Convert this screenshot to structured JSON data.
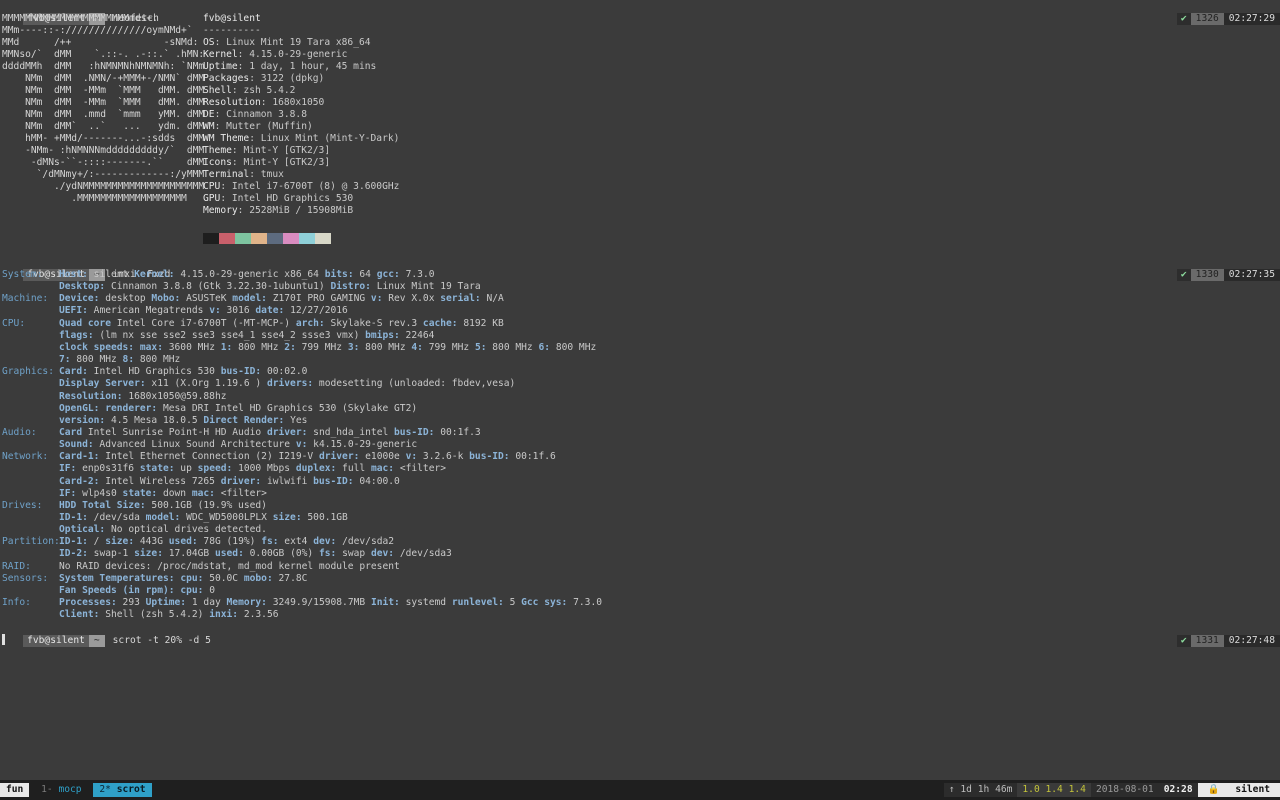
{
  "prompts": [
    {
      "host": "fvb@silent",
      "dir": "~",
      "command": "neofetch",
      "status": "✔",
      "hist": "1326",
      "time": "02:27:29"
    },
    {
      "host": "fvb@silent",
      "dir": "~",
      "command": "inxi -Fxzd",
      "status": "✔",
      "hist": "1330",
      "time": "02:27:35"
    },
    {
      "host": "fvb@silent",
      "dir": "~",
      "command": "scrot -t 20% -d 5",
      "status": "✔",
      "hist": "1331",
      "time": "02:27:48"
    }
  ],
  "neofetch": {
    "ascii": [
      "MMMMMMMMMMMMMMMMMMMMMMmds+.",
      "MMm----::-://////////////oymNMd+`",
      "MMd      /++                -sNMd:",
      "MMNso/`  dMM    `.::-. .-::.` .hMN:",
      "ddddMMh  dMM   :hNMNMNhNMNMNh: `NMm",
      "    NMm  dMM  .NMN/-+MMM+-/NMN` dMM",
      "    NMm  dMM  -MMm  `MMM   dMM. dMM",
      "    NMm  dMM  -MMm  `MMM   dMM. dMM",
      "    NMm  dMM  .mmd  `mmm   yMM. dMM",
      "    NMm  dMM`  ..`   ...   ydm. dMM",
      "    hMM- +MMd/-------...-:sdds  dMM",
      "    -NMm- :hNMNNNmdddddddddy/`  dMM",
      "     -dMNs-``-::::-------.``    dMM",
      "      `/dMNmy+/:-------------:/yMMM",
      "         ./ydNMMMMMMMMMMMMMMMMMMMMM",
      "            .MMMMMMMMMMMMMMMMMMM"
    ],
    "title": "fvb@silent",
    "separator": "----------",
    "info": [
      {
        "key": "OS",
        "val": "Linux Mint 19 Tara x86_64"
      },
      {
        "key": "Kernel",
        "val": "4.15.0-29-generic"
      },
      {
        "key": "Uptime",
        "val": "1 day, 1 hour, 45 mins"
      },
      {
        "key": "Packages",
        "val": "3122 (dpkg)"
      },
      {
        "key": "Shell",
        "val": "zsh 5.4.2"
      },
      {
        "key": "Resolution",
        "val": "1680x1050"
      },
      {
        "key": "DE",
        "val": "Cinnamon 3.8.8"
      },
      {
        "key": "WM",
        "val": "Mutter (Muffin)"
      },
      {
        "key": "WM Theme",
        "val": "Linux Mint (Mint-Y-Dark)"
      },
      {
        "key": "Theme",
        "val": "Mint-Y [GTK2/3]"
      },
      {
        "key": "Icons",
        "val": "Mint-Y [GTK2/3]"
      },
      {
        "key": "Terminal",
        "val": "tmux"
      },
      {
        "key": "CPU",
        "val": "Intel i7-6700T (8) @ 3.600GHz"
      },
      {
        "key": "GPU",
        "val": "Intel HD Graphics 530"
      },
      {
        "key": "Memory",
        "val": "2528MiB / 15908MiB"
      }
    ],
    "palette": [
      "#1e1e1e",
      "#c9606b",
      "#7ec4a0",
      "#e0b48a",
      "#5d6b7f",
      "#d98cc0",
      "#8fd0d8",
      "#d8d8c8"
    ]
  },
  "inxi": [
    {
      "sec": "System:",
      "parts": [
        [
          "k",
          "Host:"
        ],
        [
          "v",
          " silent "
        ],
        [
          "k",
          "Kernel:"
        ],
        [
          "v",
          " 4.15.0-29-generic x86_64 "
        ],
        [
          "k",
          "bits:"
        ],
        [
          "v",
          " 64 "
        ],
        [
          "k",
          "gcc:"
        ],
        [
          "v",
          " 7.3.0"
        ]
      ]
    },
    {
      "sec": "",
      "parts": [
        [
          "k",
          "Desktop:"
        ],
        [
          "v",
          " Cinnamon 3.8.8 (Gtk 3.22.30-1ubuntu1) "
        ],
        [
          "k",
          "Distro:"
        ],
        [
          "v",
          " Linux Mint 19 Tara"
        ]
      ]
    },
    {
      "sec": "Machine:",
      "parts": [
        [
          "k",
          "Device:"
        ],
        [
          "v",
          " desktop "
        ],
        [
          "k",
          "Mobo:"
        ],
        [
          "v",
          " ASUSTeK "
        ],
        [
          "k",
          "model:"
        ],
        [
          "v",
          " Z170I PRO GAMING "
        ],
        [
          "k",
          "v:"
        ],
        [
          "v",
          " Rev X.0x "
        ],
        [
          "k",
          "serial:"
        ],
        [
          "v",
          " N/A"
        ]
      ]
    },
    {
      "sec": "",
      "parts": [
        [
          "k",
          "UEFI:"
        ],
        [
          "v",
          " American Megatrends "
        ],
        [
          "k",
          "v:"
        ],
        [
          "v",
          " 3016 "
        ],
        [
          "k",
          "date:"
        ],
        [
          "v",
          " 12/27/2016"
        ]
      ]
    },
    {
      "sec": "CPU:",
      "parts": [
        [
          "k",
          "Quad core"
        ],
        [
          "v",
          " Intel Core i7-6700T (-MT-MCP-) "
        ],
        [
          "k",
          "arch:"
        ],
        [
          "v",
          " Skylake-S rev.3 "
        ],
        [
          "k",
          "cache:"
        ],
        [
          "v",
          " 8192 KB"
        ]
      ]
    },
    {
      "sec": "",
      "parts": [
        [
          "k",
          "flags:"
        ],
        [
          "v",
          " (lm nx sse sse2 sse3 sse4_1 sse4_2 ssse3 vmx) "
        ],
        [
          "k",
          "bmips:"
        ],
        [
          "v",
          " 22464"
        ]
      ]
    },
    {
      "sec": "",
      "parts": [
        [
          "k",
          "clock speeds:"
        ],
        [
          "v",
          " "
        ],
        [
          "k",
          "max:"
        ],
        [
          "v",
          " 3600 MHz "
        ],
        [
          "k",
          "1:"
        ],
        [
          "v",
          " 800 MHz "
        ],
        [
          "k",
          "2:"
        ],
        [
          "v",
          " 799 MHz "
        ],
        [
          "k",
          "3:"
        ],
        [
          "v",
          " 800 MHz "
        ],
        [
          "k",
          "4:"
        ],
        [
          "v",
          " 799 MHz "
        ],
        [
          "k",
          "5:"
        ],
        [
          "v",
          " 800 MHz "
        ],
        [
          "k",
          "6:"
        ],
        [
          "v",
          " 800 MHz"
        ]
      ]
    },
    {
      "sec": "",
      "parts": [
        [
          "k",
          "7:"
        ],
        [
          "v",
          " 800 MHz "
        ],
        [
          "k",
          "8:"
        ],
        [
          "v",
          " 800 MHz"
        ]
      ]
    },
    {
      "sec": "Graphics:",
      "parts": [
        [
          "k",
          "Card:"
        ],
        [
          "v",
          " Intel HD Graphics 530 "
        ],
        [
          "k",
          "bus-ID:"
        ],
        [
          "v",
          " 00:02.0"
        ]
      ]
    },
    {
      "sec": "",
      "parts": [
        [
          "k",
          "Display Server:"
        ],
        [
          "v",
          " x11 (X.Org 1.19.6 ) "
        ],
        [
          "k",
          "drivers:"
        ],
        [
          "v",
          " modesetting (unloaded: fbdev,vesa)"
        ]
      ]
    },
    {
      "sec": "",
      "parts": [
        [
          "k",
          "Resolution:"
        ],
        [
          "v",
          " 1680x1050@59.88hz"
        ]
      ]
    },
    {
      "sec": "",
      "parts": [
        [
          "k",
          "OpenGL:"
        ],
        [
          "v",
          " "
        ],
        [
          "k",
          "renderer:"
        ],
        [
          "v",
          " Mesa DRI Intel HD Graphics 530 (Skylake GT2)"
        ]
      ]
    },
    {
      "sec": "",
      "parts": [
        [
          "k",
          "version:"
        ],
        [
          "v",
          " 4.5 Mesa 18.0.5 "
        ],
        [
          "k",
          "Direct Render:"
        ],
        [
          "v",
          " Yes"
        ]
      ]
    },
    {
      "sec": "Audio:",
      "parts": [
        [
          "k",
          "Card"
        ],
        [
          "v",
          " Intel Sunrise Point-H HD Audio "
        ],
        [
          "k",
          "driver:"
        ],
        [
          "v",
          " snd_hda_intel "
        ],
        [
          "k",
          "bus-ID:"
        ],
        [
          "v",
          " 00:1f.3"
        ]
      ]
    },
    {
      "sec": "",
      "parts": [
        [
          "k",
          "Sound:"
        ],
        [
          "v",
          " Advanced Linux Sound Architecture "
        ],
        [
          "k",
          "v:"
        ],
        [
          "v",
          " k4.15.0-29-generic"
        ]
      ]
    },
    {
      "sec": "Network:",
      "parts": [
        [
          "k",
          "Card-1:"
        ],
        [
          "v",
          " Intel Ethernet Connection (2) I219-V "
        ],
        [
          "k",
          "driver:"
        ],
        [
          "v",
          " e1000e "
        ],
        [
          "k",
          "v:"
        ],
        [
          "v",
          " 3.2.6-k "
        ],
        [
          "k",
          "bus-ID:"
        ],
        [
          "v",
          " 00:1f.6"
        ]
      ]
    },
    {
      "sec": "",
      "parts": [
        [
          "k",
          "IF:"
        ],
        [
          "v",
          " enp0s31f6 "
        ],
        [
          "k",
          "state:"
        ],
        [
          "v",
          " up "
        ],
        [
          "k",
          "speed:"
        ],
        [
          "v",
          " 1000 Mbps "
        ],
        [
          "k",
          "duplex:"
        ],
        [
          "v",
          " full "
        ],
        [
          "k",
          "mac:"
        ],
        [
          "v",
          " <filter>"
        ]
      ]
    },
    {
      "sec": "",
      "parts": [
        [
          "k",
          "Card-2:"
        ],
        [
          "v",
          " Intel Wireless 7265 "
        ],
        [
          "k",
          "driver:"
        ],
        [
          "v",
          " iwlwifi "
        ],
        [
          "k",
          "bus-ID:"
        ],
        [
          "v",
          " 04:00.0"
        ]
      ]
    },
    {
      "sec": "",
      "parts": [
        [
          "k",
          "IF:"
        ],
        [
          "v",
          " wlp4s0 "
        ],
        [
          "k",
          "state:"
        ],
        [
          "v",
          " down "
        ],
        [
          "k",
          "mac:"
        ],
        [
          "v",
          " <filter>"
        ]
      ]
    },
    {
      "sec": "Drives:",
      "parts": [
        [
          "k",
          "HDD Total Size:"
        ],
        [
          "v",
          " 500.1GB (19.9% used)"
        ]
      ]
    },
    {
      "sec": "",
      "parts": [
        [
          "k",
          "ID-1:"
        ],
        [
          "v",
          " /dev/sda "
        ],
        [
          "k",
          "model:"
        ],
        [
          "v",
          " WDC_WD5000LPLX "
        ],
        [
          "k",
          "size:"
        ],
        [
          "v",
          " 500.1GB"
        ]
      ]
    },
    {
      "sec": "",
      "parts": [
        [
          "k",
          "Optical:"
        ],
        [
          "v",
          " No optical drives detected."
        ]
      ]
    },
    {
      "sec": "Partition:",
      "parts": [
        [
          "k",
          "ID-1:"
        ],
        [
          "v",
          " / "
        ],
        [
          "k",
          "size:"
        ],
        [
          "v",
          " 443G "
        ],
        [
          "k",
          "used:"
        ],
        [
          "v",
          " 78G (19%) "
        ],
        [
          "k",
          "fs:"
        ],
        [
          "v",
          " ext4 "
        ],
        [
          "k",
          "dev:"
        ],
        [
          "v",
          " /dev/sda2"
        ]
      ]
    },
    {
      "sec": "",
      "parts": [
        [
          "k",
          "ID-2:"
        ],
        [
          "v",
          " swap-1 "
        ],
        [
          "k",
          "size:"
        ],
        [
          "v",
          " 17.04GB "
        ],
        [
          "k",
          "used:"
        ],
        [
          "v",
          " 0.00GB (0%) "
        ],
        [
          "k",
          "fs:"
        ],
        [
          "v",
          " swap "
        ],
        [
          "k",
          "dev:"
        ],
        [
          "v",
          " /dev/sda3"
        ]
      ]
    },
    {
      "sec": "RAID:",
      "parts": [
        [
          "v",
          "No RAID devices: /proc/mdstat, md_mod kernel module present"
        ]
      ]
    },
    {
      "sec": "Sensors:",
      "parts": [
        [
          "k",
          "System Temperatures:"
        ],
        [
          "v",
          " "
        ],
        [
          "k",
          "cpu:"
        ],
        [
          "v",
          " 50.0C "
        ],
        [
          "k",
          "mobo:"
        ],
        [
          "v",
          " 27.8C"
        ]
      ]
    },
    {
      "sec": "",
      "parts": [
        [
          "k",
          "Fan Speeds (in rpm):"
        ],
        [
          "v",
          " "
        ],
        [
          "k",
          "cpu:"
        ],
        [
          "v",
          " 0"
        ]
      ]
    },
    {
      "sec": "Info:",
      "parts": [
        [
          "k",
          "Processes:"
        ],
        [
          "v",
          " 293 "
        ],
        [
          "k",
          "Uptime:"
        ],
        [
          "v",
          " 1 day "
        ],
        [
          "k",
          "Memory:"
        ],
        [
          "v",
          " 3249.9/15908.7MB "
        ],
        [
          "k",
          "Init:"
        ],
        [
          "v",
          " systemd "
        ],
        [
          "k",
          "runlevel:"
        ],
        [
          "v",
          " 5 "
        ],
        [
          "k",
          "Gcc sys:"
        ],
        [
          "v",
          " 7.3.0"
        ]
      ]
    },
    {
      "sec": "",
      "parts": [
        [
          "k",
          "Client:"
        ],
        [
          "v",
          " Shell (zsh 5.4.2) "
        ],
        [
          "k",
          "inxi:"
        ],
        [
          "v",
          " 2.3.56"
        ]
      ]
    }
  ],
  "statusbar": {
    "session": "fun",
    "windows": [
      {
        "index": "1-",
        "name": "mocp",
        "current": false
      },
      {
        "index": "2*",
        "name": "scrot",
        "current": true
      }
    ],
    "uptime": "↑ 1d 1h 46m",
    "load": "1.0 1.4 1.4",
    "date": "2018-08-01",
    "time": "02:28",
    "host": "silent",
    "lock_icon": "🔒"
  }
}
